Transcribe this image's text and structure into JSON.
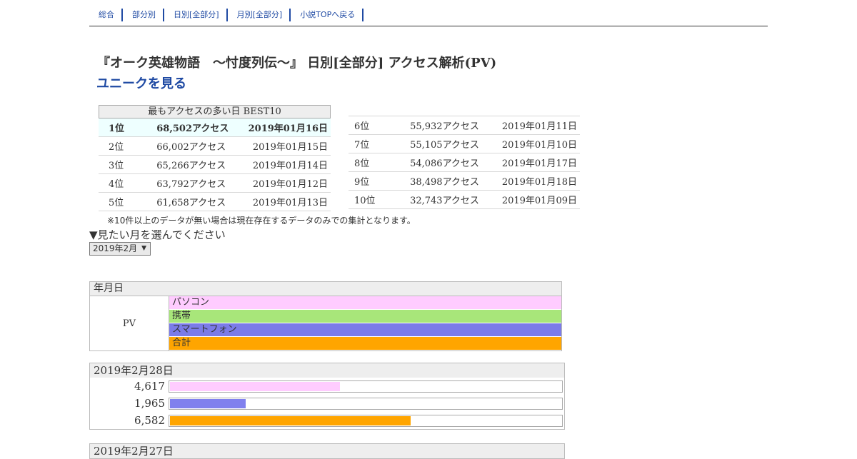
{
  "nav": [
    {
      "label": "総合"
    },
    {
      "label": "部分別"
    },
    {
      "label": "日別[全部分]"
    },
    {
      "label": "月別[全部分]"
    },
    {
      "label": "小説TOPへ戻る"
    }
  ],
  "title": "『オーク英雄物語　～忖度列伝～』 日別[全部分] アクセス解析(PV)",
  "unique_link": "ユニークを見る",
  "best10": {
    "caption": "最もアクセスの多い日 BEST10",
    "left": [
      {
        "rank": "1位",
        "access": "68,502アクセス",
        "date": "2019年01月16日"
      },
      {
        "rank": "2位",
        "access": "66,002アクセス",
        "date": "2019年01月15日"
      },
      {
        "rank": "3位",
        "access": "65,266アクセス",
        "date": "2019年01月14日"
      },
      {
        "rank": "4位",
        "access": "63,792アクセス",
        "date": "2019年01月12日"
      },
      {
        "rank": "5位",
        "access": "61,658アクセス",
        "date": "2019年01月13日"
      }
    ],
    "right": [
      {
        "rank": "6位",
        "access": "55,932アクセス",
        "date": "2019年01月11日"
      },
      {
        "rank": "7位",
        "access": "55,105アクセス",
        "date": "2019年01月10日"
      },
      {
        "rank": "8位",
        "access": "54,086アクセス",
        "date": "2019年01月17日"
      },
      {
        "rank": "9位",
        "access": "38,498アクセス",
        "date": "2019年01月18日"
      },
      {
        "rank": "10位",
        "access": "32,743アクセス",
        "date": "2019年01月09日"
      }
    ]
  },
  "note": "※10件以上のデータが無い場合は現在存在するデータのみでの集計となります。",
  "month_prompt": "▼見たい月を選んでください",
  "month_select": {
    "selected": "2019年2月"
  },
  "legend": {
    "head": "年月日",
    "pv": "PV",
    "items": [
      {
        "label": "パソコン",
        "color": "#ffccff"
      },
      {
        "label": "携帯",
        "color": "#a8e67a"
      },
      {
        "label": "スマートフォン",
        "color": "#7b7be8"
      },
      {
        "label": "合計",
        "color": "#ffa500"
      }
    ]
  },
  "colors": {
    "pc": "#ffccff",
    "smartphone": "#8080ee",
    "total": "#ffa500"
  },
  "days": [
    {
      "date": "2019年2月28日",
      "rows": [
        {
          "value": "4,617",
          "fraction": 0.433,
          "series": "pc"
        },
        {
          "value": "1,965",
          "fraction": 0.193,
          "series": "smartphone"
        },
        {
          "value": "6,582",
          "fraction": 0.612,
          "series": "total"
        }
      ]
    },
    {
      "date": "2019年2月27日",
      "rows": []
    }
  ]
}
